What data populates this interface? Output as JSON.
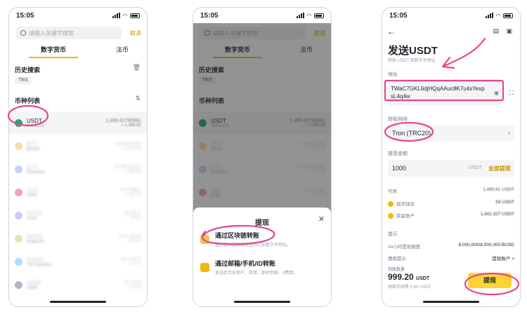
{
  "status": {
    "time": "15:05"
  },
  "search": {
    "placeholder": "请输入关键字搜索",
    "cancel": "取消"
  },
  "tabs": [
    "数字货币",
    "法币"
  ],
  "history": {
    "title": "历史搜索",
    "chips": [
      "TRX"
    ]
  },
  "coin_list": {
    "title": "币种列表",
    "items": [
      {
        "symbol": "USDT",
        "name": "TetherUS",
        "amount": "1,495.62780881",
        "sub": "≈ 1,495.62",
        "color": "#26a17b",
        "blurred": false
      },
      {
        "symbol": "BTC",
        "name": "Bitcoin",
        "amount": "0.03251022",
        "sub": "≈ 1,032.04",
        "color": "#f7931a",
        "blurred": true
      },
      {
        "symbol": "ETH",
        "name": "Ethereum",
        "amount": "0.29816457",
        "sub": "≈ 560.36",
        "color": "#627eea",
        "blurred": true
      },
      {
        "symbol": "CHZ",
        "name": "Chiliz",
        "amount": "913.3891",
        "sub": "≈ 120.12",
        "color": "#cd0124",
        "blurred": true
      },
      {
        "symbol": "DYDX",
        "name": "dYdX",
        "amount": "36.5017",
        "sub": "≈ 80.57",
        "color": "#6966ff",
        "blurred": true
      },
      {
        "symbol": "DOGE",
        "name": "Dogecoin",
        "amount": "372.11190",
        "sub": "≈ 40.40",
        "color": "#c2a633",
        "blurred": true
      },
      {
        "symbol": "SAND",
        "name": "The Sandbox",
        "amount": "26.02471",
        "sub": "≈ 20.72",
        "color": "#00adef",
        "blurred": true
      },
      {
        "symbol": "ARPA",
        "name": "ARPA",
        "amount": "371.023",
        "sub": "≈ 15.11",
        "color": "#1e2d5a",
        "blurred": true
      }
    ]
  },
  "sheet": {
    "title": "提现",
    "options": [
      {
        "title": "通过区块链转账",
        "desc": "通过区块链网络发送到已知数字币地址。"
      },
      {
        "title": "通过邮箱/手机/ID转账",
        "desc": "发送给币安用户，简单、即时到账、0费用。"
      }
    ]
  },
  "send": {
    "title": "发送USDT",
    "subtitle": "转账 USDT 到数字币地址",
    "address_label": "地址",
    "address": "TWaC7GKL6djHQqAAuc8K7u4sYexpsL4q4w",
    "network_label": "转账网络",
    "network": "Tron (TRC20)",
    "amount_label": "提现金额",
    "amount": "1000",
    "amount_unit": "USDT",
    "all_label": "全部提现",
    "available_label": "可用",
    "available_value": "1,495.61 USDT",
    "spot_label": "现货钱包",
    "spot_value": "54 USDT",
    "funding_label": "资金账户",
    "funding_value": "1,441.327 USDT",
    "tips_label": "提示",
    "limit_label": "24小时提现额度",
    "limit_value": "8,000,000/8,000,000 BUSD",
    "fee_label": "费用提示",
    "fee_link": "提现账户 >",
    "receive_label": "到账数量",
    "receive_amount": "999.20",
    "receive_unit": "USDT",
    "fee_note": "网络手续费 0.80 USDT",
    "withdraw_button": "提现"
  }
}
